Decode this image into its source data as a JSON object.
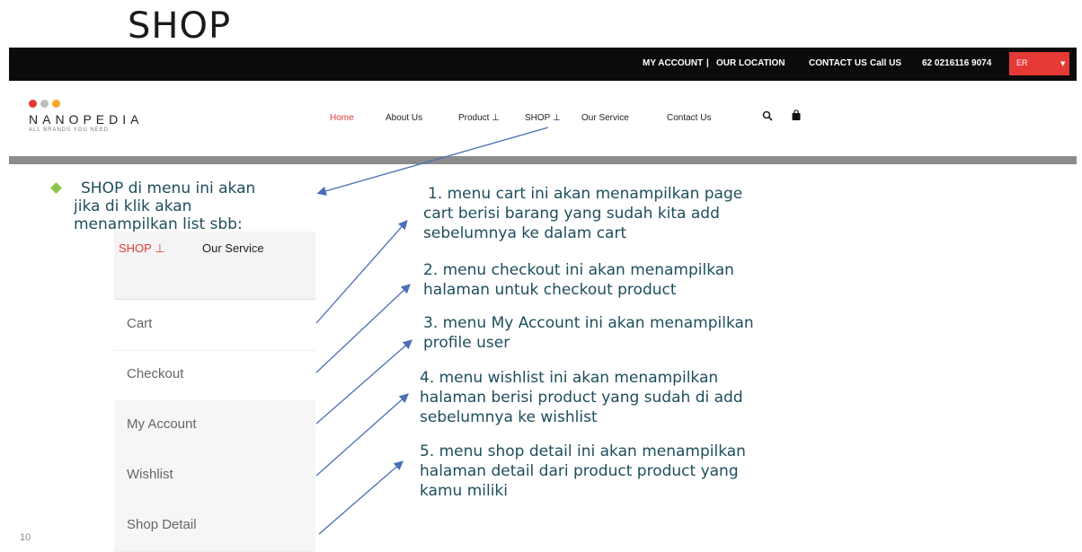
{
  "slide": {
    "title": "SHOP",
    "page_number": "10"
  },
  "topbar": {
    "my_account": "MY ACCOUNT",
    "separator": "|",
    "our_location": "OUR LOCATION",
    "contact_us": "CONTACT US",
    "call_us": "Call US",
    "phone": "62 0216116 9074",
    "language": "ER"
  },
  "navbar": {
    "brand": "NANOPEDIA",
    "tagline": "ALL BRANDS YOU NEED",
    "dot_colors": [
      "#e53935",
      "#bdbdbd",
      "#f9a825"
    ],
    "items": [
      "Home",
      "About Us",
      "Product ⊥",
      "SHOP ⊥",
      "Our Service",
      "Contact Us"
    ],
    "search_icon": "search-icon",
    "cart_icon": "cart-icon"
  },
  "dropdown": {
    "shop_label": "SHOP ⊥",
    "our_service": "Our Service",
    "items": [
      "Cart",
      "Checkout",
      "My Account",
      "Wishlist",
      "Shop Detail"
    ]
  },
  "notes": {
    "intro": [
      "SHOP di menu ini akan",
      "jika di klik akan",
      "menampilkan list sbb:"
    ],
    "n1": [
      "1. menu cart ini akan menampilkan page",
      "cart berisi barang yang sudah kita add",
      "sebelumnya ke dalam cart"
    ],
    "n2": [
      "2. menu checkout ini akan menampilkan",
      "halaman untuk checkout product"
    ],
    "n3": [
      "3. menu My Account ini akan menampilkan",
      "profile user"
    ],
    "n4": [
      "4. menu wishlist ini akan menampilkan",
      "halaman berisi product yang sudah di add",
      "sebelumnya   ke wishlist"
    ],
    "n5": [
      "5. menu shop detail ini akan menampilkan",
      "halaman detail dari product product yang",
      "kamu miliki"
    ]
  },
  "colors": {
    "accent_red": "#e53935",
    "note_text": "#1d4e5c",
    "arrow": "#4a6fb5",
    "bullet": "#8bc34a"
  }
}
